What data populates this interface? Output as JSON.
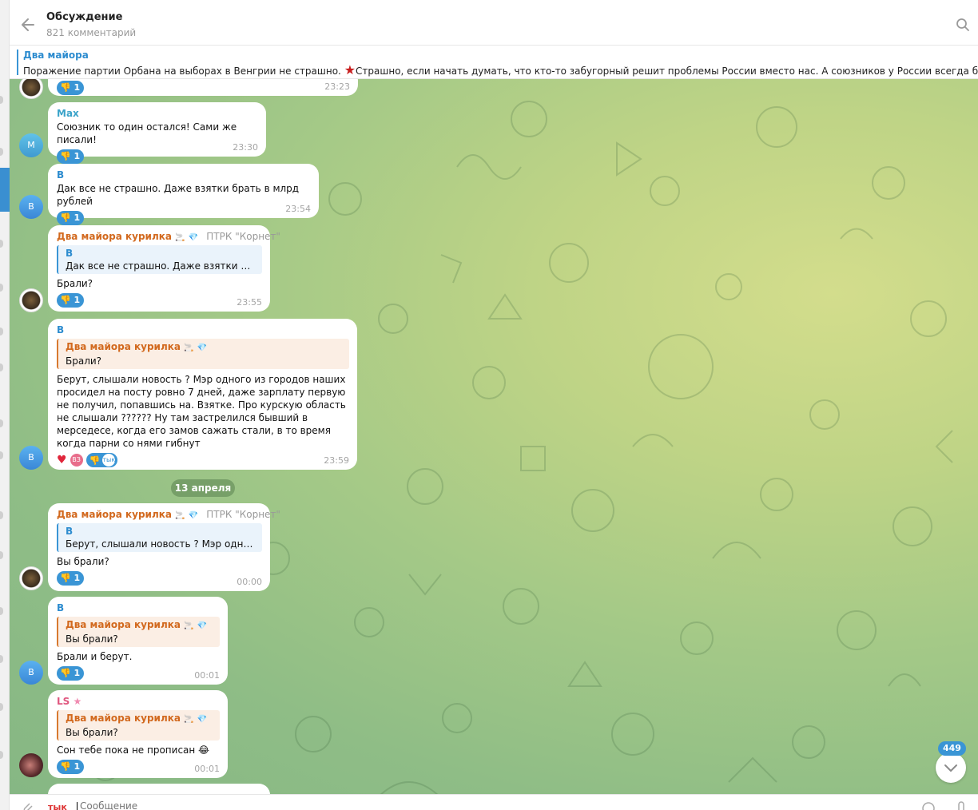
{
  "header": {
    "title": "Обсуждение",
    "subtitle": "821 комментарий"
  },
  "pinned": {
    "title": "Два майора",
    "text_before": "Поражение партии Орбана на выборах в Венгрии не страшно.",
    "text_after": "Страшно, если начать думать, что кто-то забугорный решит проблемы России вместо нас.   А союзников у России всегда было два. ..."
  },
  "messages": [
    {
      "reaction_count": "1",
      "time": "23:23"
    },
    {
      "author": "Max",
      "avatar": "M",
      "text": "Союзник то один остался! Сами же писали!",
      "reaction_count": "1",
      "time": "23:30"
    },
    {
      "author": "B",
      "avatar": "B",
      "text": "Дак все не страшно. Даже взятки брать в млрд рублей",
      "reaction_count": "1",
      "time": "23:54"
    },
    {
      "author": "Два майора курилка",
      "tag": "ПТРК \"Корнет\"",
      "quote_author": "B",
      "quote_text": "Дак все не страшно. Даже взятки брать...",
      "text": "Брали?",
      "reaction_count": "1",
      "time": "23:55"
    },
    {
      "author": "B",
      "avatar": "B",
      "quote_author": "Два майора курилка",
      "quote_text": "Брали?",
      "text": "Берут, слышали новость ? Мэр одного из городов наших просидел на посту ровно 7 дней, даже зарплату первую не получил, попавшись на. Взятке. Про курскую область не слышали ?????? Ну там застрелился бывший в мерседесе, когда его замов сажать стали, в то время когда парни со нями гибнут",
      "small_avatar": "ВЗ",
      "reaction_tag": "тык",
      "time": "23:59"
    },
    {
      "author": "Два майора курилка",
      "tag": "ПТРК \"Корнет\"",
      "quote_author": "B",
      "quote_text": "Берут, слышали новость ? Мэр одного ...",
      "text": "Вы брали?",
      "reaction_count": "1",
      "time": "00:00"
    },
    {
      "author": "B",
      "avatar": "B",
      "quote_author": "Два майора курилка",
      "quote_text": "Вы брали?",
      "text": "Брали и берут.",
      "reaction_count": "1",
      "time": "00:01"
    },
    {
      "author": "LS",
      "quote_author": "Два майора курилка",
      "quote_text": "Вы брали?",
      "text": "Сон тебе пока не прописан 😂",
      "reaction_count": "1",
      "time": "00:01"
    }
  ],
  "date_separator": "13 апреля",
  "scroll": {
    "unread_count": "449"
  },
  "composer": {
    "tag": "тык",
    "placeholder": "Сообщение"
  },
  "colors": {
    "accent": "#3a95d5",
    "author_orange": "#d2691e",
    "author_blue": "#2d8ccf",
    "author_cyan": "#3aa3c9",
    "author_pink": "#e0577f"
  }
}
